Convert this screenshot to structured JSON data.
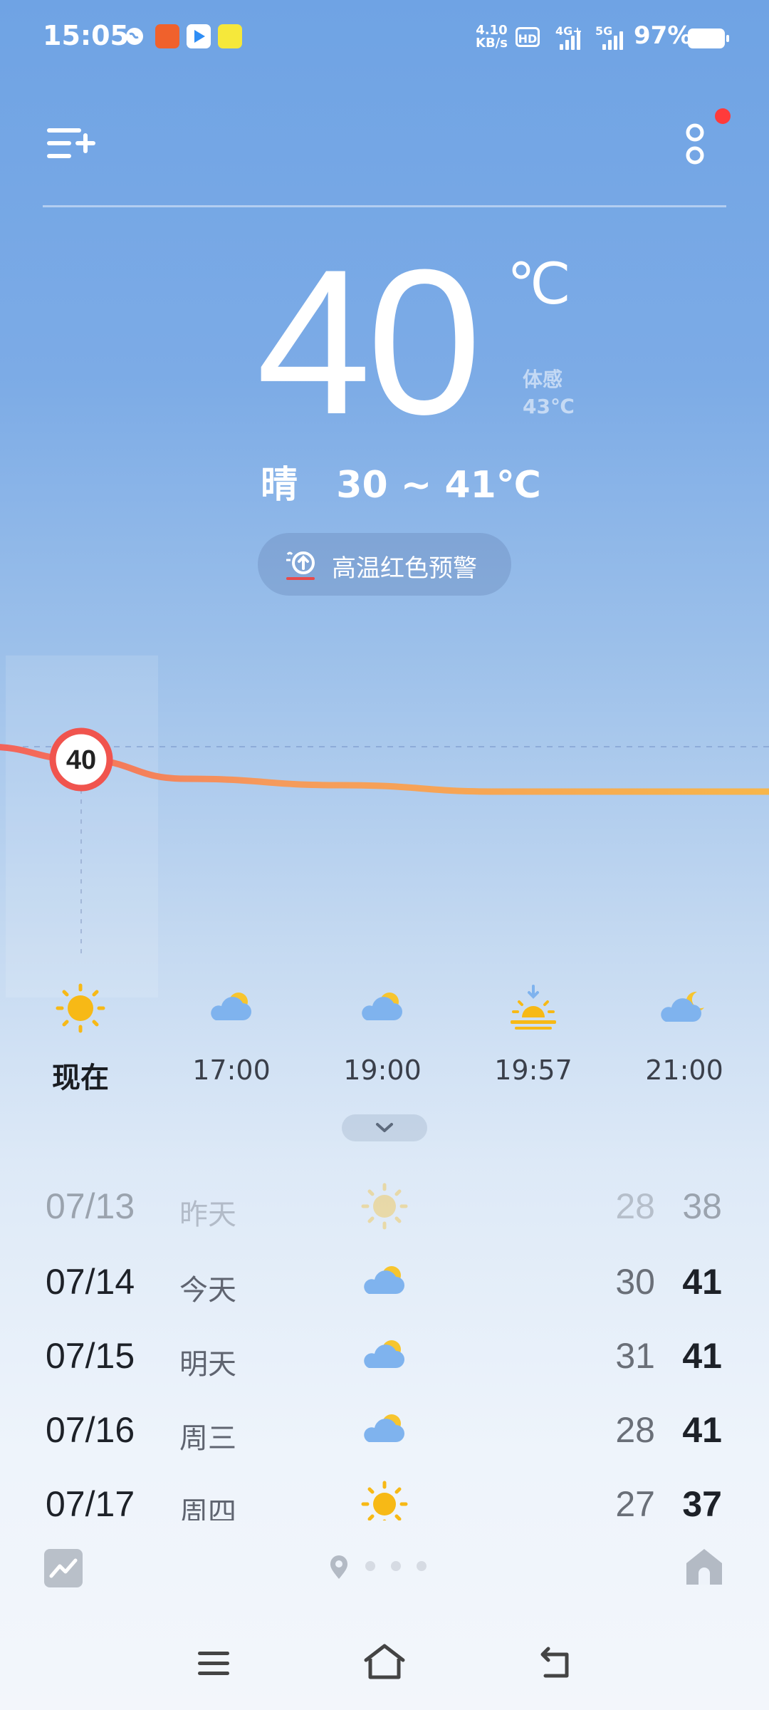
{
  "status_bar": {
    "time": "15:05",
    "net_speed_top": "4.10",
    "net_speed_unit": "KB/s",
    "hd_label": "HD",
    "signal_4g": "4G+",
    "signal_5g": "5G",
    "battery": "97%"
  },
  "current": {
    "temperature": "40",
    "unit": "℃",
    "feels_label": "体感",
    "feels_value": "43℃",
    "condition_text": "晴   30 ~ 41℃"
  },
  "alert": {
    "text": "高温红色预警"
  },
  "chart_data": {
    "type": "line",
    "series": [
      {
        "values": [
          40,
          39,
          37.5,
          37,
          36.5,
          36.5,
          36.5
        ]
      }
    ],
    "highlight_label": "40"
  },
  "hourly": [
    {
      "label": "现在",
      "icon": "sun-icon"
    },
    {
      "label": "17:00",
      "icon": "partly-cloudy-icon"
    },
    {
      "label": "19:00",
      "icon": "partly-cloudy-icon"
    },
    {
      "label": "19:57",
      "icon": "sunset-icon"
    },
    {
      "label": "21:00",
      "icon": "cloudy-night-icon"
    }
  ],
  "daily": [
    {
      "date": "07/13",
      "day": "昨天",
      "icon": "sun-icon",
      "low": "28",
      "high": "38"
    },
    {
      "date": "07/14",
      "day": "今天",
      "icon": "partly-cloudy-icon",
      "low": "30",
      "high": "41"
    },
    {
      "date": "07/15",
      "day": "明天",
      "icon": "partly-cloudy-icon",
      "low": "31",
      "high": "41"
    },
    {
      "date": "07/16",
      "day": "周三",
      "icon": "partly-cloudy-icon",
      "low": "28",
      "high": "41"
    },
    {
      "date": "07/17",
      "day": "周四",
      "icon": "sun-icon",
      "low": "27",
      "high": "37"
    }
  ],
  "colors": {
    "sun": "#f7b916",
    "cloud": "#7fb3ee",
    "curve_start": "#f3605a",
    "curve_end": "#f7b74a"
  }
}
